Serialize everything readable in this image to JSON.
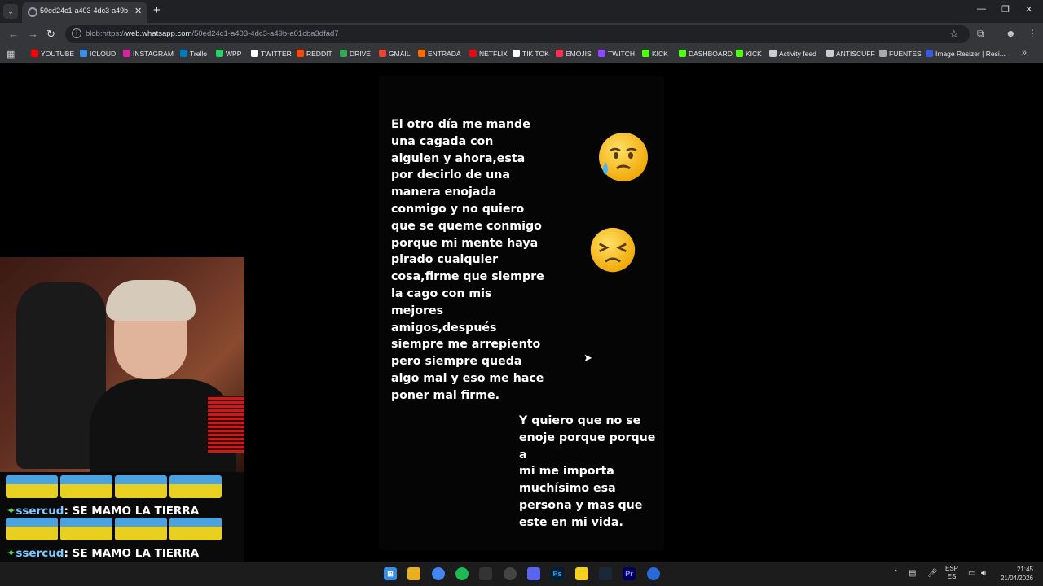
{
  "browser": {
    "tab_title": "50ed24c1-a403-4dc3-a49b-a01",
    "tab_close": "✕",
    "new_tab": "+",
    "url_prefix": "blob:https://",
    "url_host": "web.whatsapp.com",
    "url_path": "/50ed24c1-a403-4dc3-a49b-a01cba3dfad7",
    "window_controls": [
      "—",
      "❐",
      "✕"
    ]
  },
  "bookmarks": [
    {
      "label": "YOUTUBE",
      "color": "#ff0000"
    },
    {
      "label": "ICLOUD",
      "color": "#3b8eea"
    },
    {
      "label": "INSTAGRAM",
      "color": "#d6249f"
    },
    {
      "label": "Trello",
      "color": "#0079bf"
    },
    {
      "label": "WPP",
      "color": "#25d366"
    },
    {
      "label": "TWITTER",
      "color": "#ffffff"
    },
    {
      "label": "REDDIT",
      "color": "#ff4500"
    },
    {
      "label": "DRIVE",
      "color": "#34a853"
    },
    {
      "label": "GMAIL",
      "color": "#ea4335"
    },
    {
      "label": "ENTRADA",
      "color": "#ff6a00"
    },
    {
      "label": "NETFLIX",
      "color": "#e50914"
    },
    {
      "label": "TIK TOK",
      "color": "#ffffff"
    },
    {
      "label": "EMOJIS",
      "color": "#ff2d55"
    },
    {
      "label": "TWITCH",
      "color": "#9146ff"
    },
    {
      "label": "KICK",
      "color": "#53fc18"
    },
    {
      "label": "DASHBOARD",
      "color": "#53fc18"
    },
    {
      "label": "KICK",
      "color": "#53fc18"
    },
    {
      "label": "Activity feed",
      "color": "#cccccc"
    },
    {
      "label": "ANTISCUFF",
      "color": "#cccccc"
    },
    {
      "label": "FUENTES",
      "color": "#aaaaaa"
    },
    {
      "label": "Image Resizer | Resi...",
      "color": "#3b5bdb"
    }
  ],
  "story": {
    "text_main": "El otro día me mande\nuna cagada con\nalguien y ahora,esta\npor decirlo de una\nmanera enojada\nconmigo y no quiero\nque se queme conmigo\nporque mi mente haya\npirado cualquier\ncosa,firme que siempre\nla cago con mis\nmejores\namigos,después\nsiempre me arrepiento\npero siempre queda\nalgo mal y eso me hace\nponer mal firme.",
    "text_second": "Y quiero que no se\nenoje porque porque a\nmi me importa\nmuchísimo esa\npersona y mas que\neste en mi vida.",
    "emojis": [
      "crying-face",
      "persevering-face"
    ]
  },
  "chat": [
    {
      "user": "ssercud",
      "message": "SE MAMO LA TIERRA"
    },
    {
      "user": "ssercud",
      "message": "SE MAMO LA TIERRA"
    }
  ],
  "taskbar": {
    "language": "ESP",
    "layout": "ES",
    "time": "21:45",
    "date": "21/04/2026"
  }
}
